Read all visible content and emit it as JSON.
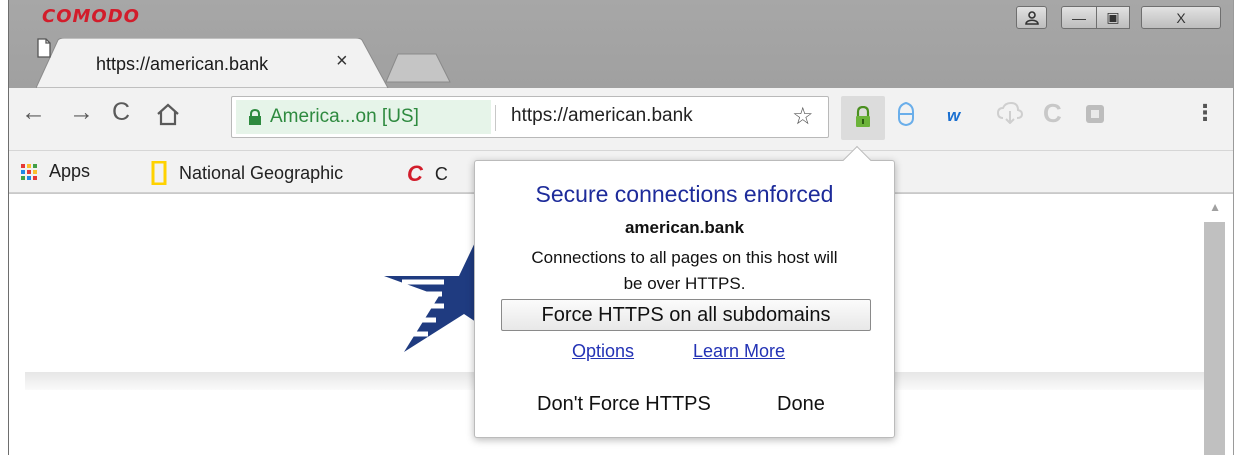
{
  "window": {
    "brand": "COMODO",
    "controls": {
      "user": "user-icon",
      "minimize": "—",
      "maximize": "▣",
      "close": "X"
    }
  },
  "tabs": [
    {
      "title": "https://american.bank",
      "close": "×",
      "icon": "page-icon"
    }
  ],
  "toolbar": {
    "back": "←",
    "forward": "→",
    "reload": "C",
    "home": "⌂",
    "ev_label": "America...on [US]",
    "url": "https://american.bank",
    "star": "☆",
    "menu": "⋮"
  },
  "bookmarks": [
    {
      "label": "Apps",
      "icon": "apps-grid-icon"
    },
    {
      "label": "National Geographic",
      "icon": "natgeo-icon"
    },
    {
      "label": "C",
      "icon": "comodo-c-icon"
    }
  ],
  "popup": {
    "title": "Secure connections enforced",
    "host": "american.bank",
    "description_line1": "Connections to all pages on this host will",
    "description_line2": "be over HTTPS.",
    "force_subdomains": "Force HTTPS on all subdomains",
    "options": "Options",
    "learn_more": "Learn More",
    "dont_force": "Don't Force HTTPS",
    "done": "Done"
  },
  "colors": {
    "brand_red": "#d21d2b",
    "ev_green": "#2e8a3f",
    "popup_title_blue": "#1d2b9a",
    "link_blue": "#2332b5",
    "logo_navy": "#1f3b80"
  }
}
